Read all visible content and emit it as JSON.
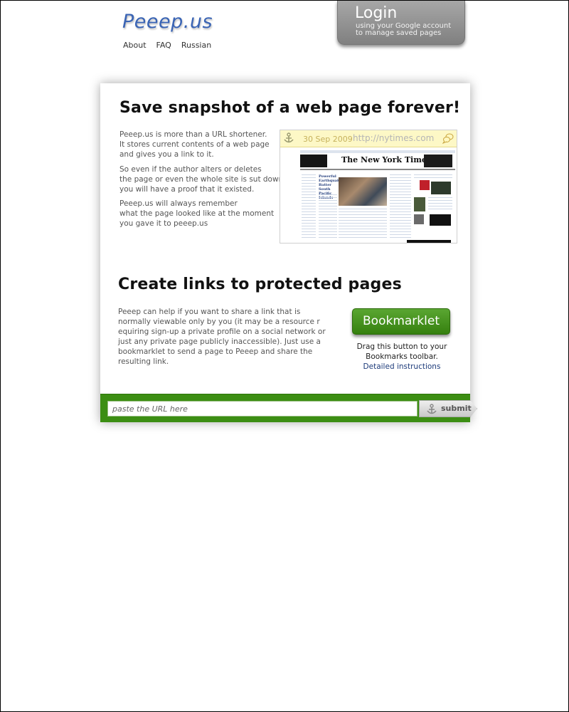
{
  "site": {
    "logo": "Peeep.us",
    "nav": [
      "About",
      "FAQ",
      "Russian"
    ]
  },
  "login": {
    "title": "Login",
    "subtitle_line1": "using your Google account",
    "subtitle_line2": "to manage saved pages"
  },
  "section1": {
    "heading": "Save snapshot of a web page forever!",
    "para1": [
      "Peeep.us is more than a URL shortener.",
      "It stores current contents of a web page",
      "and gives you a link to it."
    ],
    "para2": [
      "So even if the author alters or deletes",
      "the page or even the whole site is sut down",
      "you will have a proof that it existed."
    ],
    "para3": [
      "Peeep.us will always remember",
      "what the page looked like at the moment",
      "you gave it to peeep.us"
    ],
    "snapshot": {
      "date": "30 Sep 2009",
      "url": "http://nytimes.com",
      "masthead": "The New York Times",
      "headline1": "Powerful Earthquakes Batter South Pacific Islands"
    }
  },
  "section2": {
    "heading": "Create links to protected pages",
    "para": [
      "Peeep can help if you want to share a link that is",
      "normally viewable only by you (it may be a resource r",
      "equiring sign-up a private profile on a social network or",
      "just any private page publicly inaccessible). Just use a",
      "bookmarklet to send a page to Peeep and share the",
      "resulting link."
    ],
    "bookmarklet_label": "Bookmarklet",
    "drag_note_line1": "Drag this button to your",
    "drag_note_line2": "Bookmarks toolbar.",
    "instructions_link": "Detailed instructions"
  },
  "urlbar": {
    "placeholder": "paste the URL here",
    "submit_label": "submit"
  },
  "colors": {
    "accent_green": "#3c8e13",
    "logo_blue": "#3a64b4",
    "login_gray": "#8f8f8f"
  }
}
